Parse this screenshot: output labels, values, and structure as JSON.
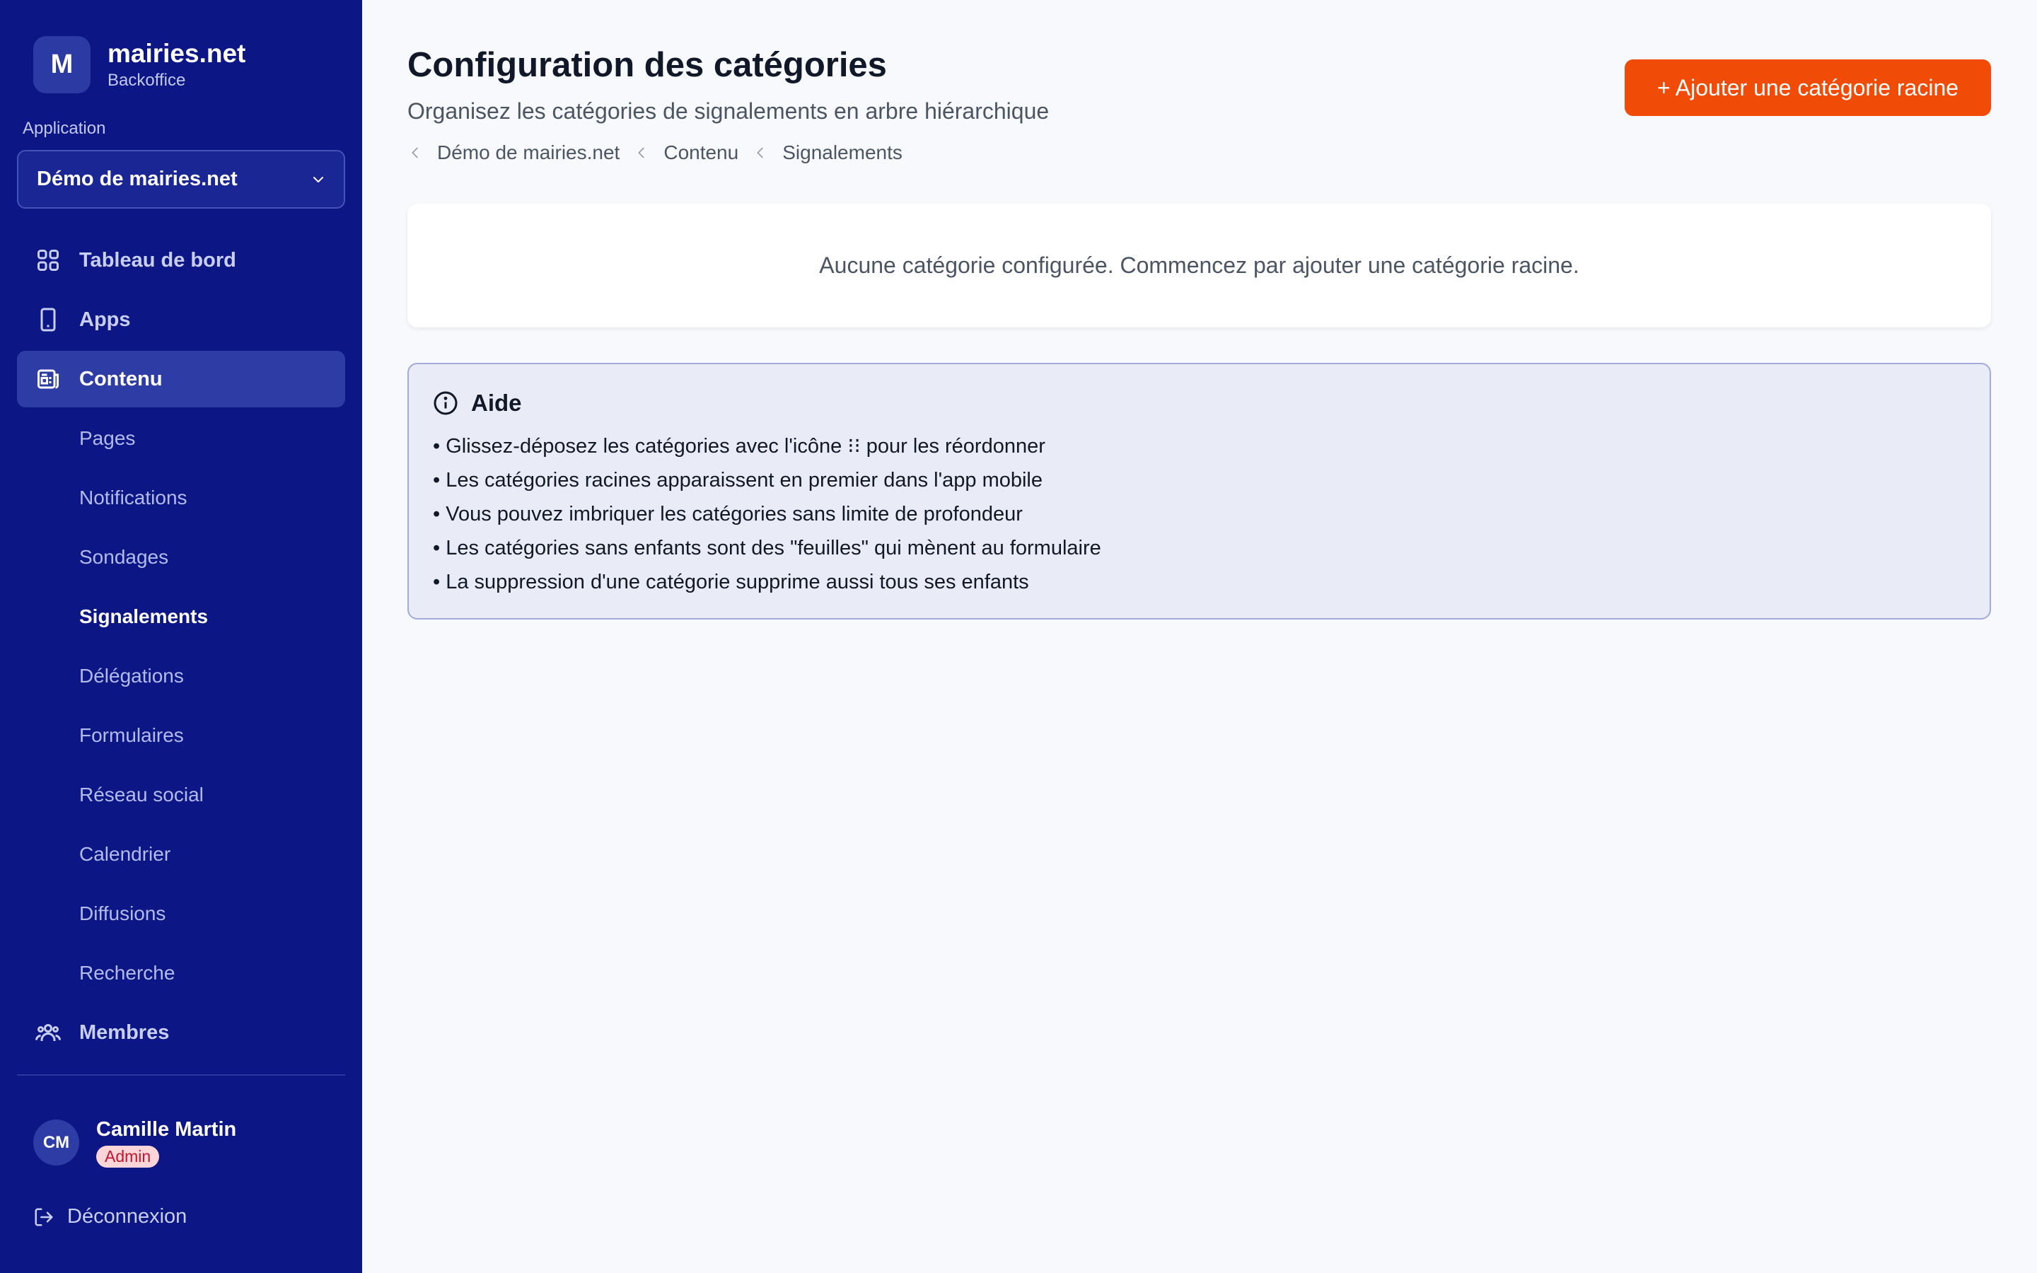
{
  "brand": {
    "logo_letter": "M",
    "name": "mairies.net",
    "subtitle": "Backoffice"
  },
  "app_selector": {
    "label": "Application",
    "value": "Démo de mairies.net"
  },
  "nav": {
    "dashboard": "Tableau de bord",
    "apps": "Apps",
    "content": "Contenu",
    "sub_items": [
      "Pages",
      "Notifications",
      "Sondages",
      "Signalements",
      "Délégations",
      "Formulaires",
      "Réseau social",
      "Calendrier",
      "Diffusions",
      "Recherche"
    ],
    "members": "Membres"
  },
  "user": {
    "initials": "CM",
    "name": "Camille Martin",
    "role": "Admin"
  },
  "logout": "Déconnexion",
  "header": {
    "title": "Configuration des catégories",
    "subtitle": "Organisez les catégories de signalements en arbre hiérarchique",
    "breadcrumb": [
      "Démo de mairies.net",
      "Contenu",
      "Signalements"
    ],
    "add_button": "+ Ajouter une catégorie racine"
  },
  "empty_state": "Aucune catégorie configurée. Commencez par ajouter une catégorie racine.",
  "help": {
    "title": "Aide",
    "items": [
      "• Glissez-déposez les catégories avec l'icône ⁝⁝ pour les réordonner",
      "• Les catégories racines apparaissent en premier dans l'app mobile",
      "• Vous pouvez imbriquer les catégories sans limite de profondeur",
      "• Les catégories sans enfants sont des \"feuilles\" qui mènent au formulaire",
      "• La suppression d'une catégorie supprime aussi tous ses enfants"
    ]
  },
  "colors": {
    "sidebar": "#0c1785",
    "accent": "#f14b08",
    "active_nav": "#2e3ca6",
    "help_bg": "#e9ebf7"
  }
}
